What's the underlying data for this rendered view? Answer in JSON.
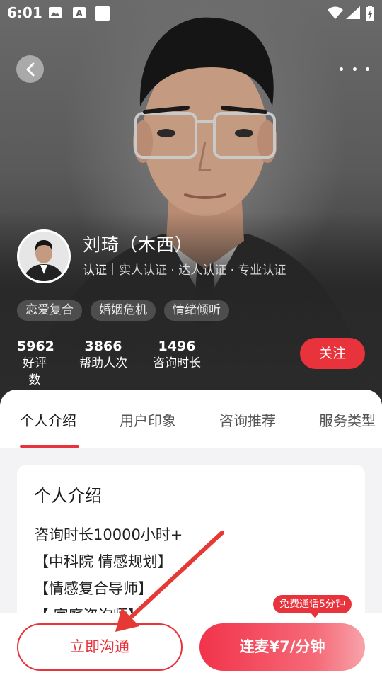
{
  "status_bar": {
    "time": "6:01"
  },
  "profile": {
    "name": "刘琦（木西）",
    "cert_main": "认证",
    "cert_detail": "实人认证 · 达人认证 · 专业认证",
    "tags": [
      "恋爱复合",
      "婚姻危机",
      "情绪倾听"
    ],
    "stats": [
      {
        "value": "5962",
        "label": "好评数"
      },
      {
        "value": "3866",
        "label": "帮助人次"
      },
      {
        "value": "1496",
        "label": "咨询时长"
      }
    ],
    "follow_label": "关注"
  },
  "tabs": [
    "个人介绍",
    "用户印象",
    "咨询推荐",
    "服务类型"
  ],
  "intro_card": {
    "title": "个人介绍",
    "lines": [
      "咨询时长10000小时+",
      "【中科院 情感规划】",
      "【情感复合导师】",
      "【 家庭咨询师】"
    ]
  },
  "bottom": {
    "chat_label": "立即沟通",
    "call_label": "连麦¥7/分钟",
    "free_badge": "免费通话5分钟"
  },
  "colors": {
    "accent": "#e8333c",
    "annotation_arrow": "#e53935"
  },
  "icons": [
    "gallery-icon",
    "font-icon",
    "app-square-icon",
    "wifi-icon",
    "signal-icon",
    "battery-icon",
    "back-icon",
    "more-icon"
  ]
}
